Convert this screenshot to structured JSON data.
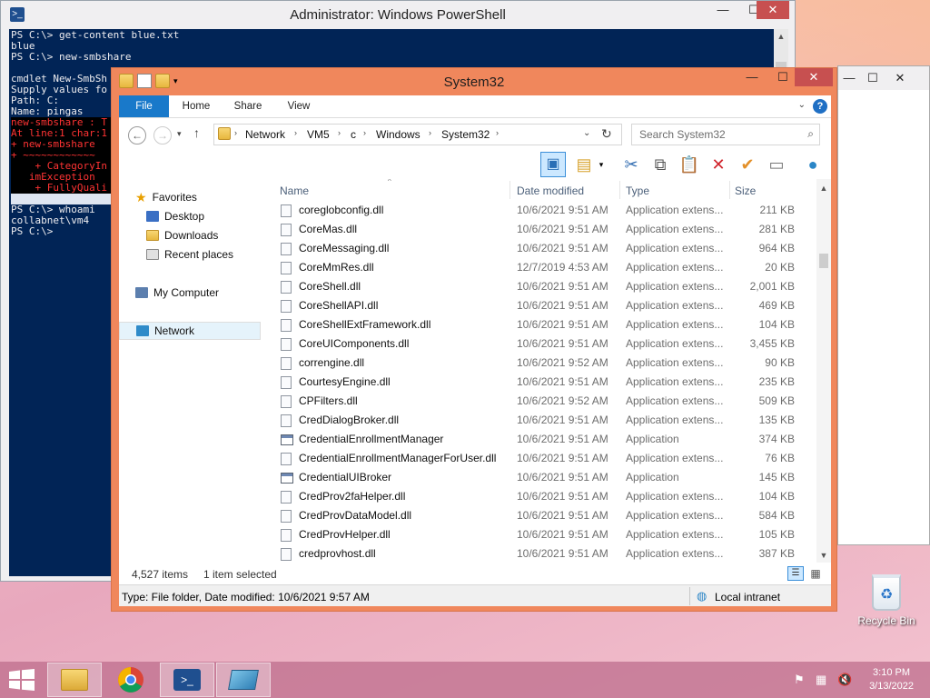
{
  "powershell": {
    "title": "Administrator: Windows PowerShell",
    "lines": [
      {
        "text": "PS C:\\> get-content blue.txt",
        "style": ""
      },
      {
        "text": "blue",
        "style": ""
      },
      {
        "text": "PS C:\\> new-smbshare",
        "style": ""
      },
      {
        "text": "",
        "style": ""
      },
      {
        "text": "cmdlet New-SmbSh",
        "style": ""
      },
      {
        "text": "Supply values fo",
        "style": ""
      },
      {
        "text": "Path: C:",
        "style": ""
      },
      {
        "text": "Name: pingas",
        "style": ""
      },
      {
        "text": "new-smbshare : T",
        "style": "err"
      },
      {
        "text": "At line:1 char:1",
        "style": "err"
      },
      {
        "text": "+ new-smbshare",
        "style": "err"
      },
      {
        "text": "+ ~~~~~~~~~~~~",
        "style": "err"
      },
      {
        "text": "    + CategoryIn",
        "style": "err"
      },
      {
        "text": "   imException",
        "style": "err"
      },
      {
        "text": "    + FullyQuali",
        "style": "err"
      },
      {
        "text": "",
        "style": "sel"
      },
      {
        "text": "PS C:\\> whoami",
        "style": ""
      },
      {
        "text": "collabnet\\vm4",
        "style": ""
      },
      {
        "text": "PS C:\\>",
        "style": ""
      }
    ]
  },
  "explorer": {
    "title": "System32",
    "tabs": {
      "file": "File",
      "home": "Home",
      "share": "Share",
      "view": "View"
    },
    "breadcrumb": [
      "Network",
      "VM5",
      "c",
      "Windows",
      "System32"
    ],
    "search_placeholder": "Search System32",
    "nav": {
      "favorites": "Favorites",
      "desktop": "Desktop",
      "downloads": "Downloads",
      "recent": "Recent places",
      "computer": "My Computer",
      "network": "Network"
    },
    "columns": {
      "name": "Name",
      "date": "Date modified",
      "type": "Type",
      "size": "Size"
    },
    "files": [
      {
        "name": "coreglobconfig.dll",
        "date": "10/6/2021 9:51 AM",
        "type": "Application extens...",
        "size": "211 KB",
        "kind": "dll"
      },
      {
        "name": "CoreMas.dll",
        "date": "10/6/2021 9:51 AM",
        "type": "Application extens...",
        "size": "281 KB",
        "kind": "dll"
      },
      {
        "name": "CoreMessaging.dll",
        "date": "10/6/2021 9:51 AM",
        "type": "Application extens...",
        "size": "964 KB",
        "kind": "dll"
      },
      {
        "name": "CoreMmRes.dll",
        "date": "12/7/2019 4:53 AM",
        "type": "Application extens...",
        "size": "20 KB",
        "kind": "dll"
      },
      {
        "name": "CoreShell.dll",
        "date": "10/6/2021 9:51 AM",
        "type": "Application extens...",
        "size": "2,001 KB",
        "kind": "dll"
      },
      {
        "name": "CoreShellAPI.dll",
        "date": "10/6/2021 9:51 AM",
        "type": "Application extens...",
        "size": "469 KB",
        "kind": "dll"
      },
      {
        "name": "CoreShellExtFramework.dll",
        "date": "10/6/2021 9:51 AM",
        "type": "Application extens...",
        "size": "104 KB",
        "kind": "dll"
      },
      {
        "name": "CoreUIComponents.dll",
        "date": "10/6/2021 9:51 AM",
        "type": "Application extens...",
        "size": "3,455 KB",
        "kind": "dll"
      },
      {
        "name": "correngine.dll",
        "date": "10/6/2021 9:52 AM",
        "type": "Application extens...",
        "size": "90 KB",
        "kind": "dll"
      },
      {
        "name": "CourtesyEngine.dll",
        "date": "10/6/2021 9:51 AM",
        "type": "Application extens...",
        "size": "235 KB",
        "kind": "dll"
      },
      {
        "name": "CPFilters.dll",
        "date": "10/6/2021 9:52 AM",
        "type": "Application extens...",
        "size": "509 KB",
        "kind": "dll"
      },
      {
        "name": "CredDialogBroker.dll",
        "date": "10/6/2021 9:51 AM",
        "type": "Application extens...",
        "size": "135 KB",
        "kind": "dll"
      },
      {
        "name": "CredentialEnrollmentManager",
        "date": "10/6/2021 9:51 AM",
        "type": "Application",
        "size": "374 KB",
        "kind": "app"
      },
      {
        "name": "CredentialEnrollmentManagerForUser.dll",
        "date": "10/6/2021 9:51 AM",
        "type": "Application extens...",
        "size": "76 KB",
        "kind": "dll"
      },
      {
        "name": "CredentialUIBroker",
        "date": "10/6/2021 9:51 AM",
        "type": "Application",
        "size": "145 KB",
        "kind": "app"
      },
      {
        "name": "CredProv2faHelper.dll",
        "date": "10/6/2021 9:51 AM",
        "type": "Application extens...",
        "size": "104 KB",
        "kind": "dll"
      },
      {
        "name": "CredProvDataModel.dll",
        "date": "10/6/2021 9:51 AM",
        "type": "Application extens...",
        "size": "584 KB",
        "kind": "dll"
      },
      {
        "name": "CredProvHelper.dll",
        "date": "10/6/2021 9:51 AM",
        "type": "Application extens...",
        "size": "105 KB",
        "kind": "dll"
      },
      {
        "name": "credprovhost.dll",
        "date": "10/6/2021 9:51 AM",
        "type": "Application extens...",
        "size": "387 KB",
        "kind": "dll"
      }
    ],
    "status": {
      "items": "4,527 items",
      "selected": "1 item selected"
    },
    "details": "Type: File folder, Date modified: 10/6/2021 9:57 AM",
    "zone": "Local intranet"
  },
  "desktop": {
    "recycle_bin": "Recycle Bin"
  },
  "clock": {
    "time": "3:10 PM",
    "date": "3/13/2022"
  },
  "colors": {
    "ps_background": "#012456",
    "explorer_frame": "#f0875c",
    "file_tab": "#1979ca"
  }
}
